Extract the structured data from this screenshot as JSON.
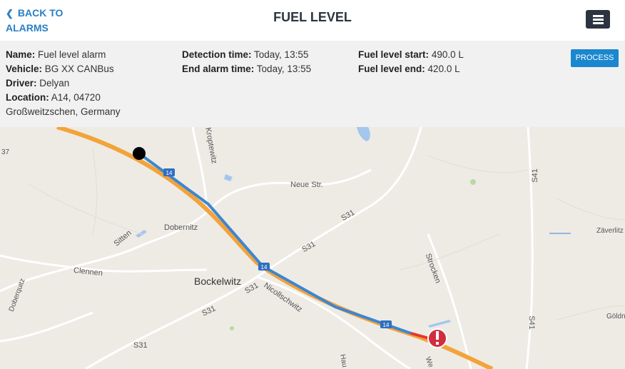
{
  "header": {
    "back_line1": "BACK TO",
    "back_line2": "ALARMS",
    "title": "FUEL LEVEL"
  },
  "details": {
    "name_label": "Name:",
    "name_value": "Fuel level alarm",
    "vehicle_label": "Vehicle:",
    "vehicle_value": "BG XX CANBus",
    "driver_label": "Driver:",
    "driver_value": "Delyan",
    "location_label": "Location:",
    "location_value": "A14, 04720",
    "location_line2": "Großweitzschen, Germany",
    "detection_label": "Detection time:",
    "detection_value": "Today, 13:55",
    "end_label": "End alarm time:",
    "end_value": "Today, 13:55",
    "fuel_start_label": "Fuel level start:",
    "fuel_start_value": "490.0 L",
    "fuel_end_label": "Fuel level end:",
    "fuel_end_value": "420.0 L",
    "process_label": "PROCESS"
  },
  "map": {
    "places": {
      "bockelwitz": "Bockelwitz",
      "dobernitz": "Dobernitz",
      "clennen": "Clennen",
      "sitten": "Sitten",
      "neue_str": "Neue Str.",
      "s31_a": "S31",
      "s31_b": "S31",
      "s31_c": "S31",
      "s31_d": "S31",
      "s31_e": "S31",
      "s41_a": "S41",
      "s41_b": "S41",
      "strocken": "Strocken",
      "nicollschwitz": "Nicollschwitz",
      "kroptewitz": "Kroptewitz",
      "zaverlitz": "Zäverlitz",
      "goldni": "Göldni",
      "doberquitz": "Doberquitz",
      "a14_1": "14",
      "a14_2": "14",
      "a14_3": "14",
      "left_37": "37",
      "hau": "Hau",
      "we": "We"
    },
    "colors": {
      "route": "#3d86d1",
      "highway": "#f2a33a",
      "alarm_marker": "#d22d3f",
      "start_marker": "#000000"
    }
  }
}
